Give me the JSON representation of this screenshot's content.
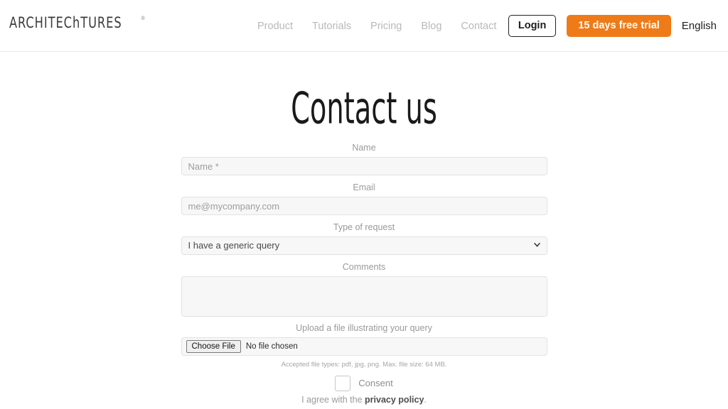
{
  "header": {
    "logo": {
      "text_before": "ARCHITEC",
      "text_h": "h",
      "text_after": "TURES",
      "trademark": "®"
    },
    "nav": [
      {
        "label": "Product"
      },
      {
        "label": "Tutorials"
      },
      {
        "label": "Pricing"
      },
      {
        "label": "Blog"
      },
      {
        "label": "Contact"
      }
    ],
    "login_label": "Login",
    "trial_label": "15 days free trial",
    "trial_color": "#EE7B18",
    "language_label": "English"
  },
  "page": {
    "title": "Contact us"
  },
  "form": {
    "name": {
      "label": "Name",
      "placeholder": "Name *",
      "value": ""
    },
    "email": {
      "label": "Email",
      "placeholder": "me@mycompany.com",
      "value": ""
    },
    "request_type": {
      "label": "Type of request",
      "selected": "I have a generic query",
      "options": [
        "I have a generic query"
      ]
    },
    "comments": {
      "label": "Comments",
      "placeholder": "",
      "value": ""
    },
    "upload": {
      "label": "Upload a file illustrating your query",
      "choose_file_label": "Choose File",
      "file_status": "No file chosen",
      "hint": "Accepted file types: pdf, jpg, png. Max. file size: 64 MB."
    },
    "consent": {
      "label": "Consent",
      "checked": false,
      "agree_prefix": "I agree with the ",
      "privacy_link": "privacy policy",
      "agree_suffix": "."
    }
  }
}
